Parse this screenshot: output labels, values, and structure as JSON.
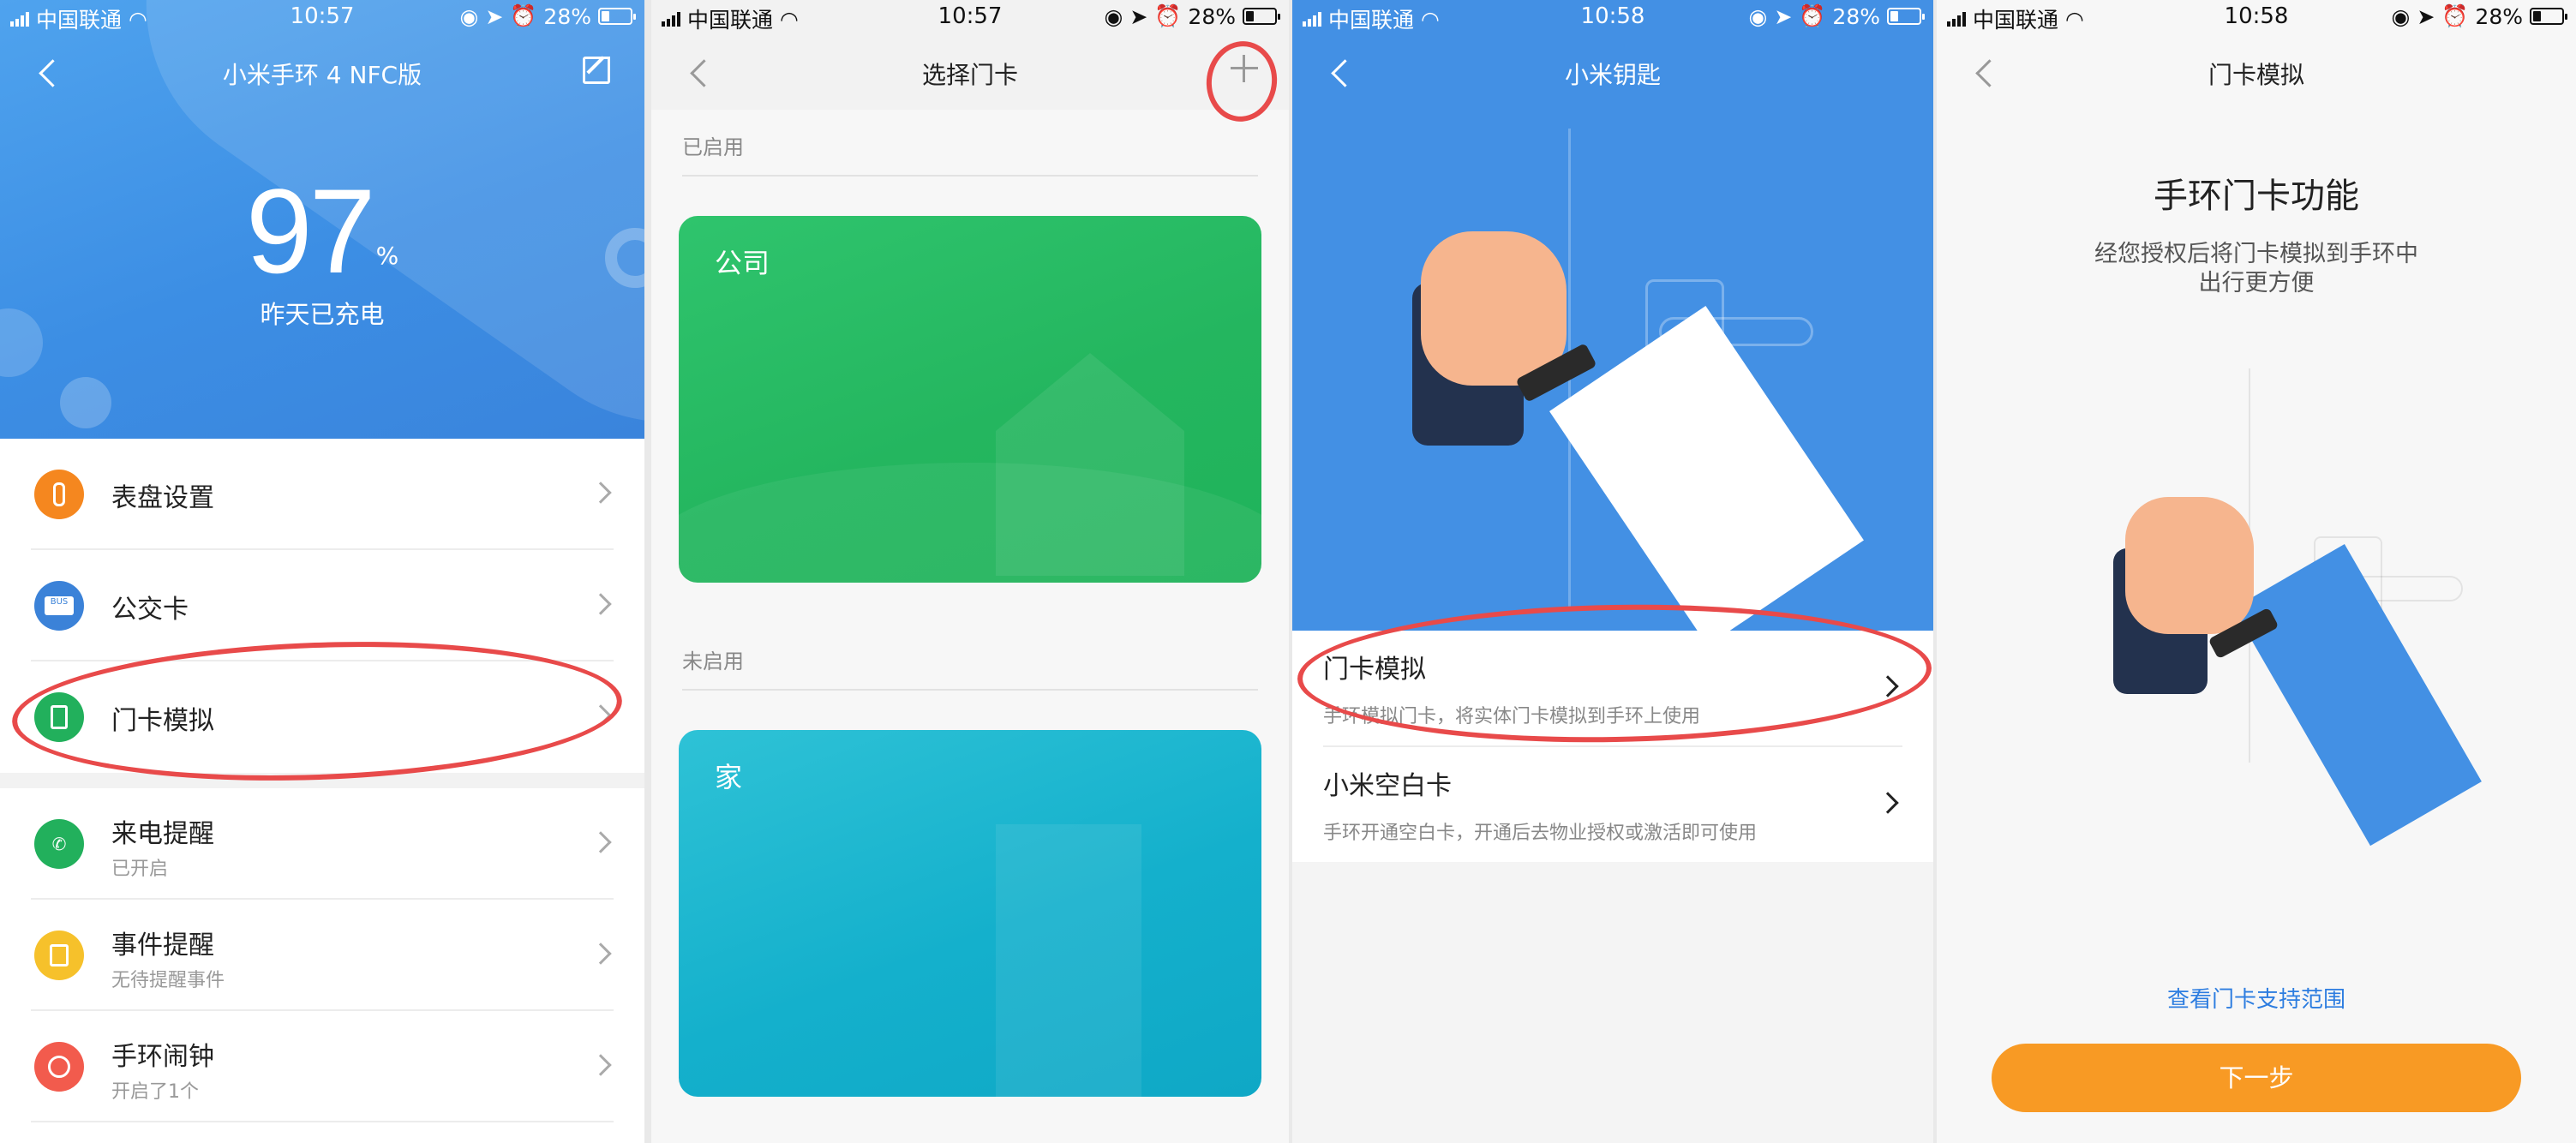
{
  "colors": {
    "accent_blue": "#3c8ee4",
    "orange": "#f89a24",
    "green_card": "#24b65f",
    "teal_card": "#14b0cc",
    "annotation_red": "#e84a4a"
  },
  "screens": [
    {
      "status": {
        "carrier": "中国联通",
        "time": "10:57",
        "battery": "28%",
        "battery_level": 0.28
      },
      "title": "小米手环 4 NFC版",
      "battery_number": "97",
      "battery_unit": "%",
      "charge_status": "昨天已充电",
      "menu": [
        {
          "label": "表盘设置",
          "icon": "watch-icon",
          "color": "#f5871f"
        },
        {
          "label": "公交卡",
          "icon": "bus-card-icon",
          "color": "#3b82d8",
          "icon_text": "BUS"
        },
        {
          "label": "门卡模拟",
          "icon": "door-card-icon",
          "color": "#22b05c"
        },
        {
          "label": "来电提醒",
          "sub": "已开启",
          "icon": "phone-icon",
          "color": "#22b05c"
        },
        {
          "label": "事件提醒",
          "sub": "无待提醒事件",
          "icon": "event-icon",
          "color": "#f6c12b"
        },
        {
          "label": "手环闹钟",
          "sub": "开启了1个",
          "icon": "alarm-icon",
          "color": "#f25b4d"
        }
      ]
    },
    {
      "status": {
        "carrier": "中国联通",
        "time": "10:57",
        "battery": "28%",
        "battery_level": 0.28
      },
      "title": "选择门卡",
      "enabled_label": "已启用",
      "disabled_label": "未启用",
      "cards": [
        {
          "name": "公司"
        },
        {
          "name": "家"
        }
      ]
    },
    {
      "status": {
        "carrier": "中国联通",
        "time": "10:58",
        "battery": "28%",
        "battery_level": 0.28
      },
      "title": "小米钥匙",
      "options": [
        {
          "title": "门卡模拟",
          "desc": "手环模拟门卡，将实体门卡模拟到手环上使用"
        },
        {
          "title": "小米空白卡",
          "desc": "手环开通空白卡，开通后去物业授权或激活即可使用"
        }
      ]
    },
    {
      "status": {
        "carrier": "中国联通",
        "time": "10:58",
        "battery": "28%",
        "battery_level": 0.28
      },
      "title": "门卡模拟",
      "feature_title": "手环门卡功能",
      "feature_desc_1": "经您授权后将门卡模拟到手环中",
      "feature_desc_2": "出行更方便",
      "link_text": "查看门卡支持范围",
      "next_label": "下一步"
    }
  ]
}
